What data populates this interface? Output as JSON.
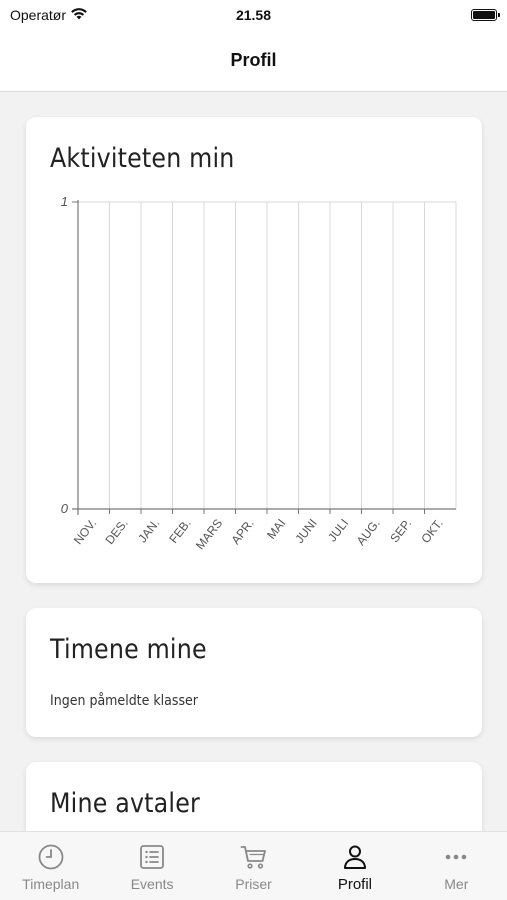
{
  "status_bar": {
    "carrier": "Operatør",
    "time": "21.58"
  },
  "nav": {
    "title": "Profil"
  },
  "activity_card": {
    "title": "Aktiviteten min"
  },
  "chart_data": {
    "type": "line",
    "title": "",
    "categories": [
      "NOV.",
      "DES.",
      "JAN.",
      "FEB.",
      "MARS",
      "APR.",
      "MAI",
      "JUNI",
      "JULI",
      "AUG.",
      "SEP.",
      "OKT."
    ],
    "series": [
      {
        "values": [
          0,
          0,
          0,
          0,
          0,
          0,
          0,
          0,
          0,
          0,
          0,
          0
        ]
      }
    ],
    "ylim": [
      0,
      1
    ],
    "yticks": [
      "0",
      "1"
    ],
    "grid": true,
    "xlabel": "",
    "ylabel": ""
  },
  "classes_card": {
    "title": "Timene mine",
    "empty_text": "Ingen påmeldte klasser"
  },
  "appointments_card": {
    "title": "Mine avtaler"
  },
  "tab_bar": {
    "items": [
      {
        "label": "Timeplan",
        "icon": "clock-icon",
        "active": false
      },
      {
        "label": "Events",
        "icon": "list-icon",
        "active": false
      },
      {
        "label": "Priser",
        "icon": "cart-icon",
        "active": false
      },
      {
        "label": "Profil",
        "icon": "person-icon",
        "active": true
      },
      {
        "label": "Mer",
        "icon": "more-icon",
        "active": false
      }
    ]
  },
  "colors": {
    "background": "#f2f2f2",
    "card": "#ffffff",
    "grid": "#d8d8d8",
    "tab_inactive": "#888888",
    "tab_active": "#111111"
  }
}
